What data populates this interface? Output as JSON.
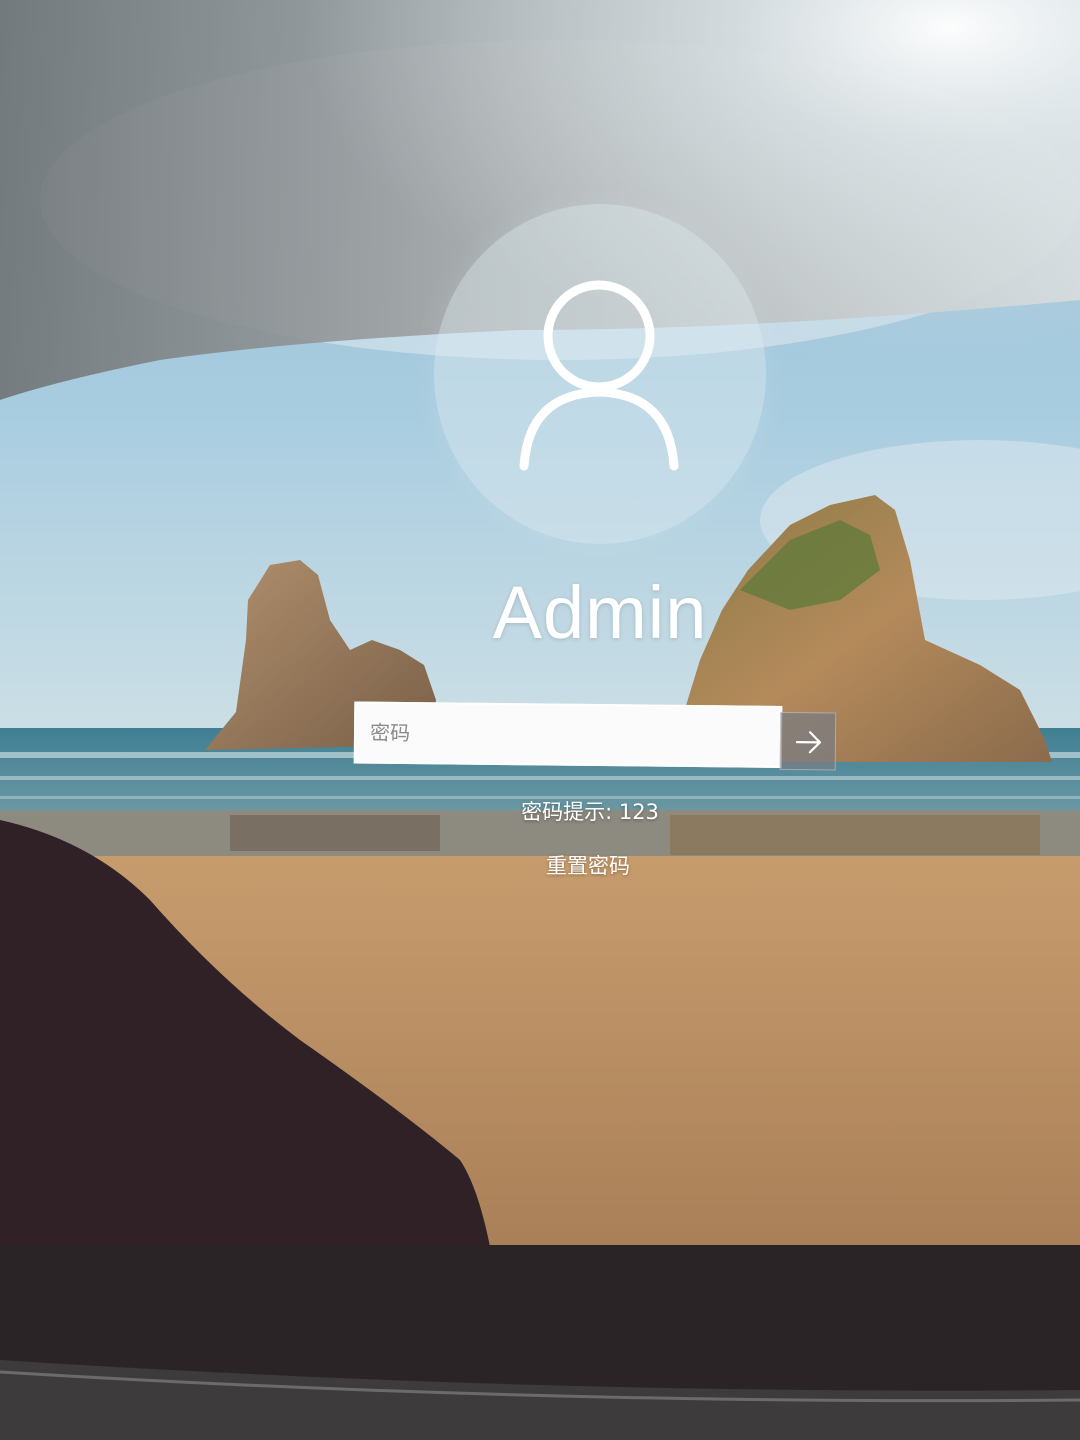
{
  "user": {
    "name": "Admin",
    "avatar_icon": "user-icon"
  },
  "password": {
    "placeholder": "密码",
    "value": "",
    "submit_icon": "arrow-right-icon"
  },
  "hint": {
    "text": "密码提示: 123"
  },
  "reset": {
    "label": "重置密码"
  },
  "colors": {
    "text": "#ffffff",
    "input_background": "#fbfbfb",
    "submit_background": "#787d82"
  }
}
